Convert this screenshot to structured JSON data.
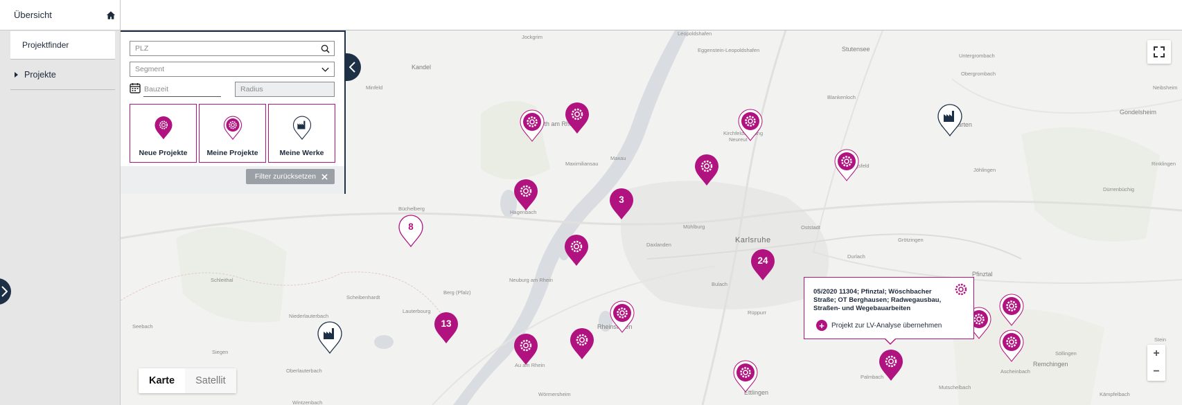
{
  "colors": {
    "brand": "#b0137f",
    "navy": "#1e3045",
    "map": "#f2f2f0"
  },
  "sidebar": {
    "title": "Übersicht",
    "home_icon": "home-icon",
    "items": [
      {
        "label": "Projektfinder",
        "selected": true
      },
      {
        "label": "Projekte",
        "selected": false,
        "expandable": true
      }
    ]
  },
  "filter": {
    "plz_placeholder": "PLZ",
    "segment_placeholder": "Segment",
    "bauzeit_placeholder": "Bauzeit",
    "radius_placeholder": "Radius",
    "tiles": [
      {
        "label": "Neue Projekte",
        "icon": "gear-pin-filled-icon"
      },
      {
        "label": "Meine Projekte",
        "icon": "gear-pin-outline-icon"
      },
      {
        "label": "Meine Werke",
        "icon": "factory-pin-icon"
      }
    ],
    "reset_label": "Filter zurücksetzen"
  },
  "map": {
    "places": [
      "Jockgrim",
      "Leopoldshafen",
      "Eggenstein-Leopoldshafen",
      "Stutensee",
      "Kandel",
      "Untergrombach",
      "Obergrombach",
      "Minfeld",
      "Blankenloch",
      "Neibsheim",
      "Wörth am Rhein",
      "Kirchfeldsiedlung",
      "Neureut",
      "Weingarten",
      "Gondelsheim",
      "Hagsfeld",
      "Maximiliansau",
      "Maxau",
      "Jöhlingen",
      "Rinklingen",
      "Büchelberg",
      "Hagenbach",
      "Mühlburg",
      "Oststadt",
      "Dürrenbüchig",
      "Daxlanden",
      "Karlsruhe",
      "Grötzingen",
      "Durlach",
      "Pfinztal",
      "Schleithal",
      "Neuburg am Rhein",
      "Bulach",
      "Berg (Pfalz)",
      "Scheibenhardt",
      "Lauterbourg",
      "Rüppurr",
      "Seebach",
      "Niederlauterbach",
      "Au am Rhein",
      "Rheinstetten",
      "Stein",
      "Siegen",
      "Söllingen",
      "Remchingen",
      "Oberlauterbach",
      "Ettlingen",
      "Palmbach",
      "Mutschelbach",
      "Ascheinbach",
      "Wörmersheim",
      "Wintzenbach",
      "Kämpfelbach"
    ],
    "cluster_counts": [
      "3",
      "8",
      "24",
      "13"
    ],
    "maptype": {
      "map": "Karte",
      "satellite": "Satellit"
    },
    "zoom_in": "+",
    "zoom_out": "−",
    "popup": {
      "text": "05/2020 11304; Pfinztal; Wöschbacher Straße; OT Berghausen; Radwegausbau, Straßen- und Wegebauarbeiten",
      "action": "Projekt zur LV-Analyse übernehmen"
    }
  }
}
